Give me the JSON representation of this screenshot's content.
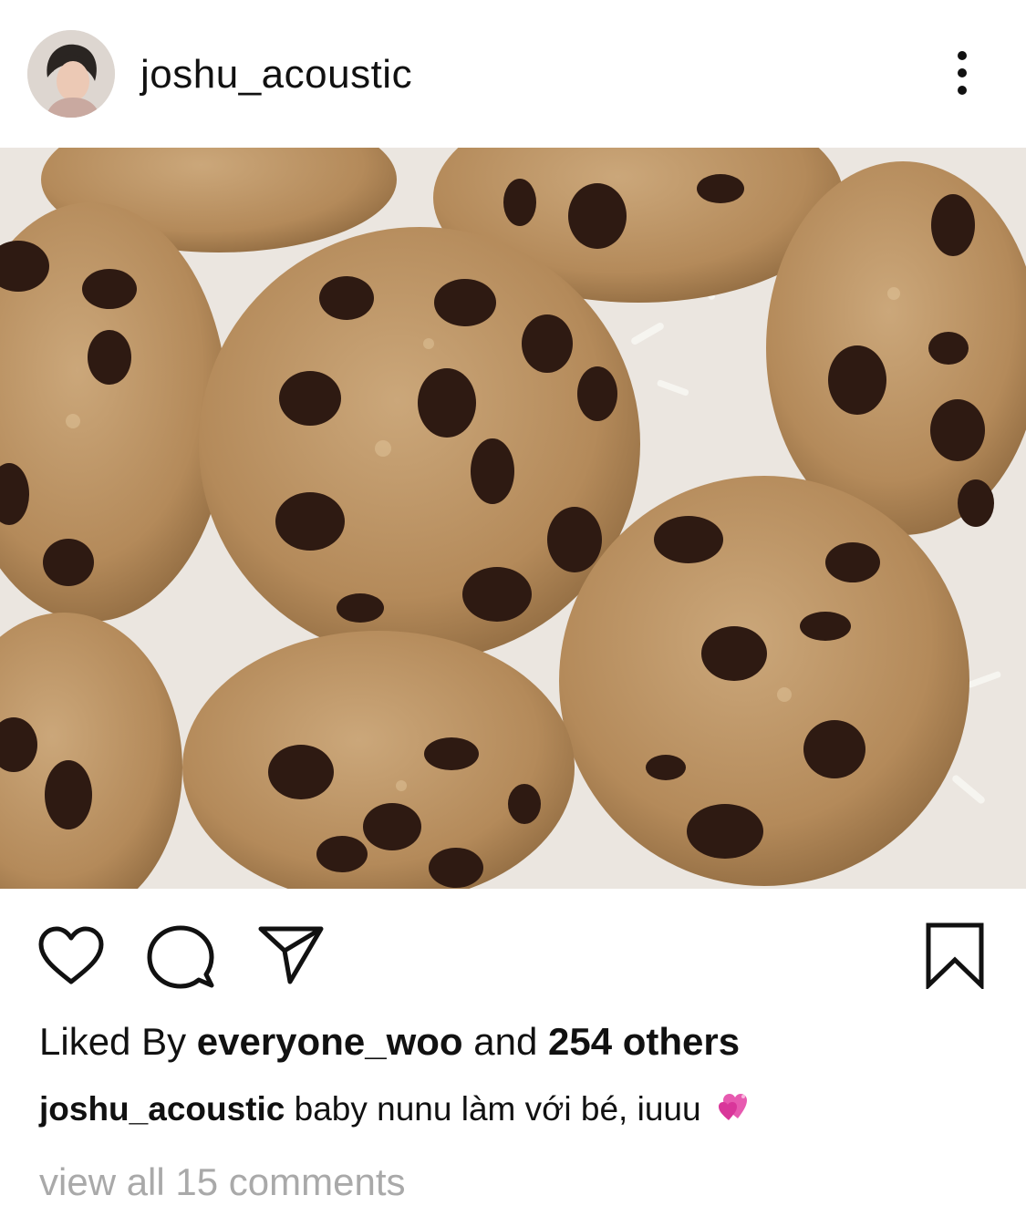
{
  "post": {
    "username": "joshu_acoustic",
    "image_alt": "chocolate chip cookies",
    "icons": {
      "more": "more-options-icon",
      "like": "heart-icon",
      "comment": "comment-icon",
      "share": "paper-plane-icon",
      "save": "bookmark-icon",
      "emoji": "heart-emoji-icon"
    },
    "likes": {
      "prefix": "Liked By ",
      "user": "everyone_woo",
      "middle": " and ",
      "count_text": "254 others"
    },
    "caption": {
      "username": "joshu_acoustic",
      "text": " baby nunu làm với bé, iuuu "
    },
    "comments_link": "view all 15 comments"
  },
  "colors": {
    "text": "#111111",
    "muted": "#a9a9a9",
    "cookie": "#b48a5a",
    "chocolate": "#2e1a12",
    "paper": "#ebe6e0"
  }
}
